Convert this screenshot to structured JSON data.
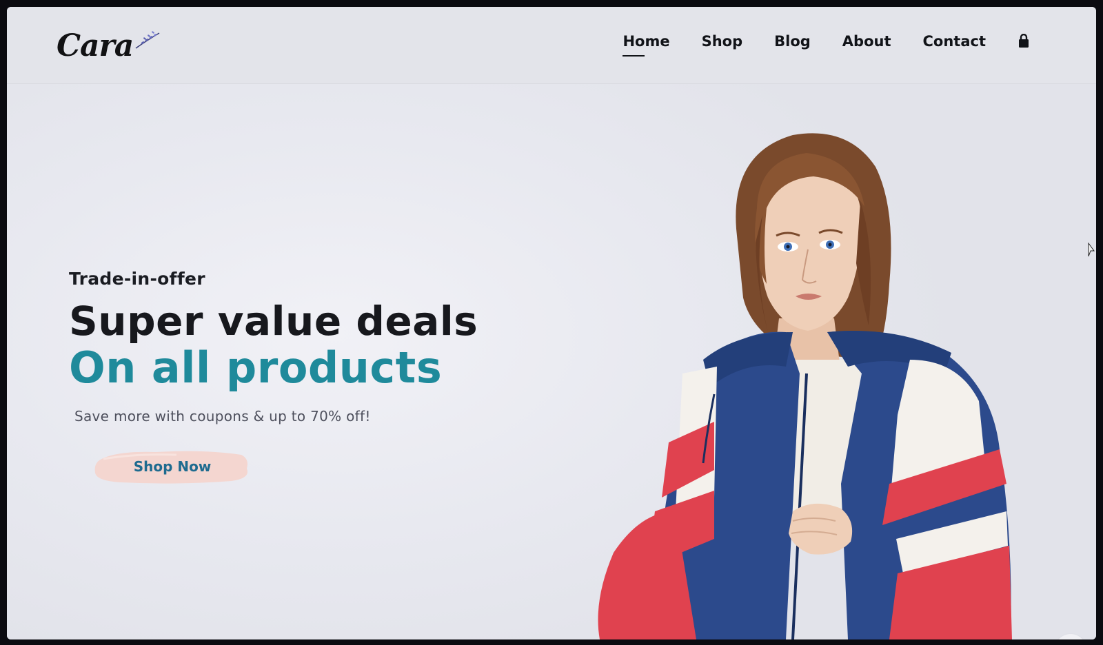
{
  "brand": {
    "logo_text": "Cara"
  },
  "nav": {
    "items": [
      {
        "label": "Home",
        "active": true
      },
      {
        "label": "Shop",
        "active": false
      },
      {
        "label": "Blog",
        "active": false
      },
      {
        "label": "About",
        "active": false
      },
      {
        "label": "Contact",
        "active": false
      }
    ],
    "cart_icon": "shopping-bag-icon"
  },
  "hero": {
    "kicker": "Trade-in-offer",
    "title": "Super value deals",
    "title_accent": "On all products",
    "subtitle": "Save more with coupons & up to 70% off!",
    "cta_label": "Shop Now"
  },
  "floating_badge": {
    "icon": "brain-icon"
  },
  "colors": {
    "accent": "#1f8a9b",
    "cta_text": "#1e6b8f",
    "cta_bg": "#f4d6d0",
    "heading": "#17181d",
    "jacket_blue": "#2c4a8c",
    "jacket_red": "#e0424f"
  }
}
